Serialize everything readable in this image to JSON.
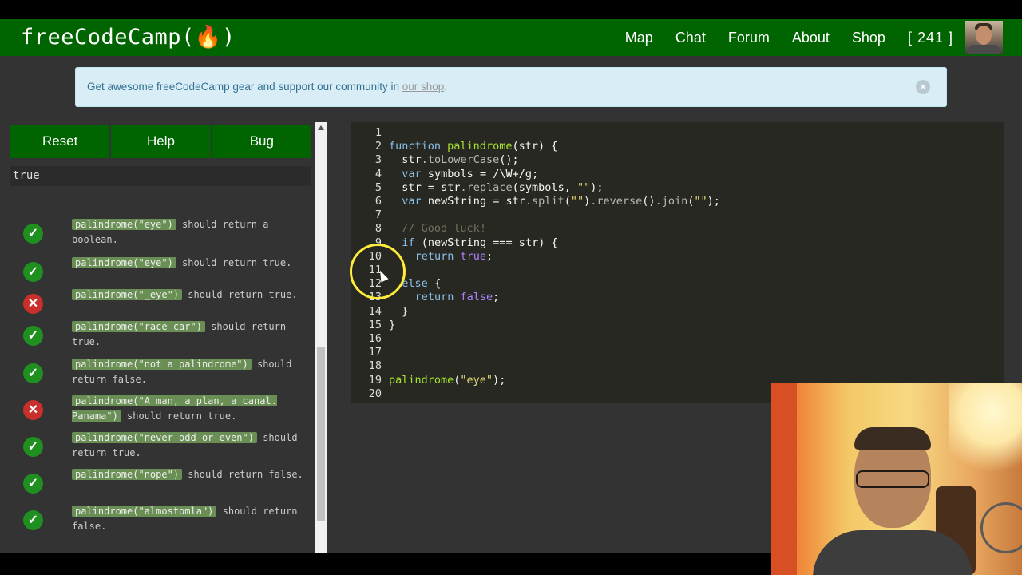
{
  "nav": {
    "logo": "freeCodeCamp(🔥)",
    "links": [
      "Map",
      "Chat",
      "Forum",
      "About",
      "Shop"
    ],
    "points": "[ 241 ]"
  },
  "alert": {
    "text": "Get awesome freeCodeCamp gear and support our community in ",
    "link_text": "our shop",
    "suffix": ".",
    "close_glyph": "×"
  },
  "buttons": {
    "reset": "Reset",
    "help": "Help",
    "bug": "Bug"
  },
  "output": "true",
  "tests": [
    {
      "status": "pass",
      "code": "palindrome(\"eye\")",
      "text": " should return a boolean."
    },
    {
      "status": "pass",
      "code": "palindrome(\"eye\")",
      "text": " should return true."
    },
    {
      "status": "fail",
      "code": "palindrome(\"_eye\")",
      "text": " should return true."
    },
    {
      "status": "pass",
      "code": "palindrome(\"race car\")",
      "text": " should return true."
    },
    {
      "status": "pass",
      "code": "palindrome(\"not a palindrome\")",
      "text": " should return false."
    },
    {
      "status": "fail",
      "code": "palindrome(\"A man, a plan, a canal. Panama\")",
      "text": " should return true."
    },
    {
      "status": "pass",
      "code": "palindrome(\"never odd or even\")",
      "text": " should return true."
    },
    {
      "status": "pass",
      "code": "palindrome(\"nope\")",
      "text": " should return false."
    },
    {
      "status": "pass",
      "code": "palindrome(\"almostomla\")",
      "text": " should return false."
    }
  ],
  "editor": {
    "lines": [
      "",
      "function palindrome(str) {",
      "  str.toLowerCase();",
      "  var symbols = /\\W+/g;",
      "  str = str.replace(symbols, \"\");",
      "  var newString = str.split(\"\").reverse().join(\"\");",
      "",
      "  // Good luck!",
      "  if (newString === str) {",
      "    return true;",
      "",
      "  else {",
      "    return false;",
      "  }",
      "}",
      "",
      "",
      "",
      "palindrome(\"eye\");",
      ""
    ]
  }
}
